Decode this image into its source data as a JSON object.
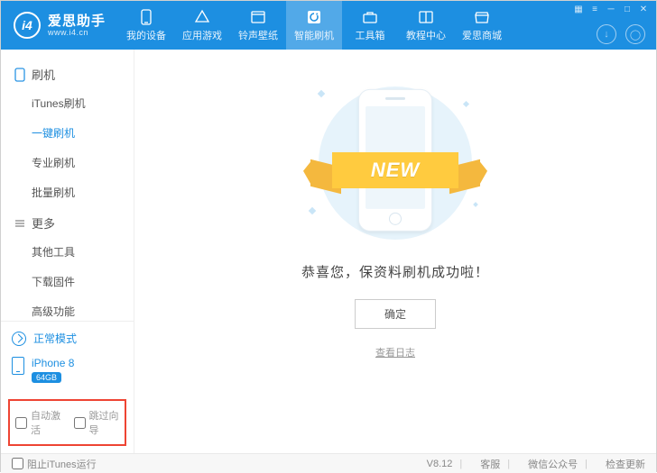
{
  "app": {
    "name": "爱思助手",
    "site": "www.i4.cn",
    "logoMark": "i4"
  },
  "window": {
    "tray": "▦",
    "menu": "≡",
    "min": "─",
    "max": "□",
    "close": "✕"
  },
  "headerTabs": [
    {
      "id": "device",
      "label": "我的设备",
      "icon": "phone-icon"
    },
    {
      "id": "apps",
      "label": "应用游戏",
      "icon": "apps-icon"
    },
    {
      "id": "ring",
      "label": "铃声壁纸",
      "icon": "media-icon"
    },
    {
      "id": "flash",
      "label": "智能刷机",
      "icon": "refresh-icon",
      "active": true
    },
    {
      "id": "toolbox",
      "label": "工具箱",
      "icon": "briefcase-icon"
    },
    {
      "id": "tutorial",
      "label": "教程中心",
      "icon": "book-icon"
    },
    {
      "id": "store",
      "label": "爱思商城",
      "icon": "store-icon"
    }
  ],
  "sidebar": {
    "groups": [
      {
        "title": "刷机",
        "icon": "phone-outline-icon",
        "items": [
          {
            "label": "iTunes刷机"
          },
          {
            "label": "一键刷机",
            "active": true
          },
          {
            "label": "专业刷机"
          },
          {
            "label": "批量刷机"
          }
        ]
      },
      {
        "title": "更多",
        "icon": "list-icon",
        "items": [
          {
            "label": "其他工具"
          },
          {
            "label": "下载固件"
          },
          {
            "label": "高级功能"
          }
        ]
      }
    ],
    "mode": "正常模式",
    "device": {
      "name": "iPhone 8",
      "storage": "64GB"
    }
  },
  "options": {
    "autoActivate": "自动激活",
    "skipGuide": "跳过向导"
  },
  "main": {
    "ribbon": "NEW",
    "message": "恭喜您，保资料刷机成功啦！",
    "ok": "确定",
    "log": "查看日志"
  },
  "footer": {
    "blockItunes": "阻止iTunes运行",
    "version": "V8.12",
    "support": "客服",
    "wechat": "微信公众号",
    "update": "检查更新"
  }
}
